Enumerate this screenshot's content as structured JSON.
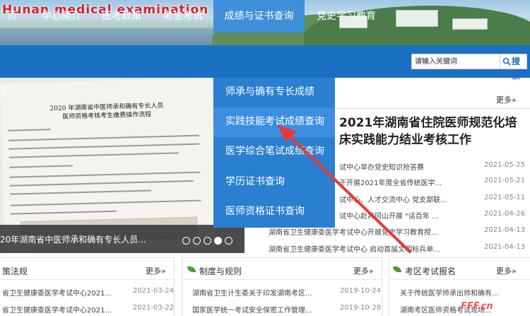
{
  "banner": {
    "title": "Hunan medical examination network"
  },
  "nav": {
    "items": [
      "页",
      "中心简介",
      "医考政策",
      "考生考试",
      "成绩与证书查询",
      "党史学习教育"
    ],
    "search_placeholder": "请输入关键词",
    "search_label": "搜索"
  },
  "dropdown": {
    "items": [
      "师承与确有专长成绩",
      "实践技能考试成绩查询",
      "医学综合笔试成绩查询",
      "学历证书查询",
      "医师资格证书查询"
    ]
  },
  "slide": {
    "doc_title_1": "2020 年湖南省中医师承和确有专长人员",
    "doc_title_2": "医师资格考核考生缴费操作流程",
    "caption": "20年湖南省中医师承和确有专长人员..."
  },
  "news": {
    "more": "更多»",
    "headline_1": "2021年湖南省住院医师规范化培",
    "headline_2": "床实践能力结业考核工作",
    "rows": [
      {
        "title": "试中心举办党史知识抢答赛",
        "date": "2021-05-25"
      },
      {
        "title": "于开展2021年度全省传统医学...",
        "date": "2021-05-21"
      },
      {
        "title": "试中心、人才交流中心 党支部联...",
        "date": "2021-05-11"
      },
      {
        "title": "试中心赴井冈山开展 \"话百年 ...",
        "date": "2021-04-26"
      },
      {
        "title": "湖南省卫生健康委医学考试中心开展党史学习教育授...",
        "date": "2021-04-13"
      },
      {
        "title": "湖南省卫生健康委医学考试中心 启动首届文明标兵单...",
        "date": "2021-04-13"
      }
    ]
  },
  "boxes": [
    {
      "title": "策法规",
      "more": "更多»",
      "rows": [
        {
          "title": "省卫生健康委医学考试中心2021...",
          "date": "2021-03-24"
        },
        {
          "title": "省卫生健康委医学考试中心2021...",
          "date": "2021-03-22"
        }
      ]
    },
    {
      "title": "制度与规则",
      "more": "更多»",
      "rows": [
        {
          "title": "湖南省卫生计生委关于印发湖南考区...",
          "date": "2019-10-24"
        },
        {
          "title": "国家医学统一考试安全保密工作管理...",
          "date": "2019-10-28"
        }
      ]
    },
    {
      "title": "考区考试报名",
      "more": "更多»",
      "rows": [
        {
          "title": "关于传统医学师承出师和确有...",
          "date": ""
        },
        {
          "title": "湖南考区医师资格考试现场...",
          "date": ""
        }
      ]
    }
  ],
  "watermark": "FFF.cn",
  "colors": {
    "nav": "#1c70c3",
    "dropdown": "#2a7fd0",
    "accent_red": "#e63a3a",
    "leaf": "#4aa02c"
  }
}
